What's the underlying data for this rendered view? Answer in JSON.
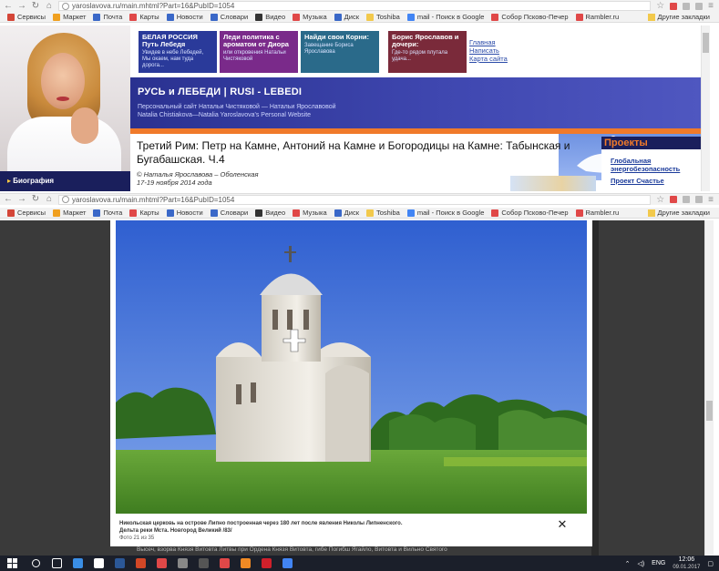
{
  "browser": {
    "url": "yaroslavova.ru/main.mhtml?Part=16&PubID=1054",
    "bookmarks": [
      {
        "label": "Сервисы",
        "icon": "apps-grid-icon",
        "color": "#d44638"
      },
      {
        "label": "Маркет",
        "icon": "market-icon",
        "color": "#f0a020"
      },
      {
        "label": "Почта",
        "icon": "mail-icon",
        "color": "#3a68c8"
      },
      {
        "label": "Карты",
        "icon": "map-pin-icon",
        "color": "#e04848"
      },
      {
        "label": "Новости",
        "icon": "news-icon",
        "color": "#3a68c8"
      },
      {
        "label": "Словари",
        "icon": "dictionary-icon",
        "color": "#3a68c8"
      },
      {
        "label": "Видео",
        "icon": "video-icon",
        "color": "#333333"
      },
      {
        "label": "Музыка",
        "icon": "music-icon",
        "color": "#e04848"
      },
      {
        "label": "Диск",
        "icon": "disk-icon",
        "color": "#3a68c8"
      },
      {
        "label": "Toshiba",
        "icon": "folder-icon",
        "color": "#f2c94c"
      },
      {
        "label": "mail - Поиск в Google",
        "icon": "google-icon",
        "color": "#4285f4"
      },
      {
        "label": "Собор Псково-Печер",
        "icon": "page-icon",
        "color": "#e04848"
      },
      {
        "label": "Rambler.ru",
        "icon": "rambler-icon",
        "color": "#e04848"
      }
    ],
    "bookmarks_second": [
      {
        "label": "Сервисы",
        "icon": "apps-grid-icon",
        "color": "#d44638"
      },
      {
        "label": "Маркет",
        "icon": "market-icon",
        "color": "#f0a020"
      },
      {
        "label": "Почта",
        "icon": "mail-icon",
        "color": "#3a68c8"
      },
      {
        "label": "Карты",
        "icon": "map-pin-icon",
        "color": "#e04848"
      },
      {
        "label": "Новости",
        "icon": "news-icon",
        "color": "#3a68c8"
      },
      {
        "label": "Словари",
        "icon": "dictionary-icon",
        "color": "#3a68c8"
      },
      {
        "label": "Видео",
        "icon": "video-icon",
        "color": "#333333"
      },
      {
        "label": "Музыка",
        "icon": "music-icon",
        "color": "#e04848"
      },
      {
        "label": "Диск",
        "icon": "disk-icon",
        "color": "#3a68c8"
      },
      {
        "label": "Toshiba",
        "icon": "folder-icon",
        "color": "#f2c94c"
      },
      {
        "label": "mail - Поиск в Google",
        "icon": "google-icon",
        "color": "#4285f4"
      },
      {
        "label": "Собор Псково-Печер",
        "icon": "page-icon",
        "color": "#e04848"
      },
      {
        "label": "Rambler.ru",
        "icon": "rambler-icon",
        "color": "#e04848"
      }
    ],
    "other_bookmarks": "Другие закладки"
  },
  "site": {
    "bio_label": "Биография",
    "tiles": [
      {
        "title": "БЕЛАЯ РОССИЯ\nПуть Лебедя",
        "sub": "Увидев в небе Лебедей, Мы окаем, нам туда дорога...",
        "color": "#2a3a9a"
      },
      {
        "title": "Леди политика с ароматом от Диора",
        "sub": "или откровения Натальи Чистяковой",
        "color": "#7a2a8a"
      },
      {
        "title": "Найди свои Корни:",
        "sub": "Завещание Бориса Ярославова",
        "color": "#2a6a8a"
      },
      {
        "title": "Борис Ярославов и дочери:",
        "sub": "Где-то рядом плутала удача...",
        "color": "#7a2a3a"
      }
    ],
    "top_links": [
      "Главная",
      "Написать",
      "Карта сайта"
    ],
    "banner_title": "РУСЬ и ЛЕБЕДИ | RUSI - LEBEDI",
    "banner_sub1": "Персональный сайт Натальи Чистяковой — Натальи Ярославовой",
    "banner_sub2": "Natalia Chistiakova—Natalia Yaroslavova's  Personal Website",
    "article_title": "Третий Рим: Петр на Камне, Антоний на Камне и Богородицы на Камне: Табынская и Бугабашская. Ч.4",
    "article_author": "© Наталья Ярославова – Оболенская",
    "article_date": "17-19 ноября 2014 года",
    "projects_head": "Проекты",
    "projects_links": [
      "Глобальная энергобезопасность",
      "Проект Счастье"
    ]
  },
  "lightbox": {
    "caption_line1": "Никольская церковь на острове Липно построенная через 180 лет после явления Николы Липненского.",
    "caption_line2": "Дельта реки Мста. Новгород Великий /83/",
    "photo_counter": "Фото 21 из 35",
    "close_glyph": "✕"
  },
  "behind_text": "Высеч, взорва Князя Витовта Литвы при Ордена Князя Витовта, гибе Погибш Ягайло, Витовта и Вильно Святого",
  "taskbar": {
    "apps": [
      {
        "icon": "search-icon",
        "color": "#ffffff"
      },
      {
        "icon": "task-view-icon",
        "color": "#ffffff"
      },
      {
        "icon": "edge-icon",
        "color": "#3a8ee6"
      },
      {
        "icon": "store-icon",
        "color": "#ffffff"
      },
      {
        "icon": "word-icon",
        "color": "#2b5797"
      },
      {
        "icon": "powerpoint-icon",
        "color": "#d24726"
      },
      {
        "icon": "yandex-icon",
        "color": "#e04848"
      },
      {
        "icon": "app-icon",
        "color": "#888888"
      },
      {
        "icon": "app-icon-2",
        "color": "#555555"
      },
      {
        "icon": "yandex-browser-icon",
        "color": "#e04848"
      },
      {
        "icon": "firefox-icon",
        "color": "#f08a24"
      },
      {
        "icon": "opera-icon",
        "color": "#d0202b"
      },
      {
        "icon": "chrome-icon",
        "color": "#4285f4"
      }
    ],
    "lang": "ENG",
    "time": "12:06",
    "date": "09.01.2017"
  }
}
